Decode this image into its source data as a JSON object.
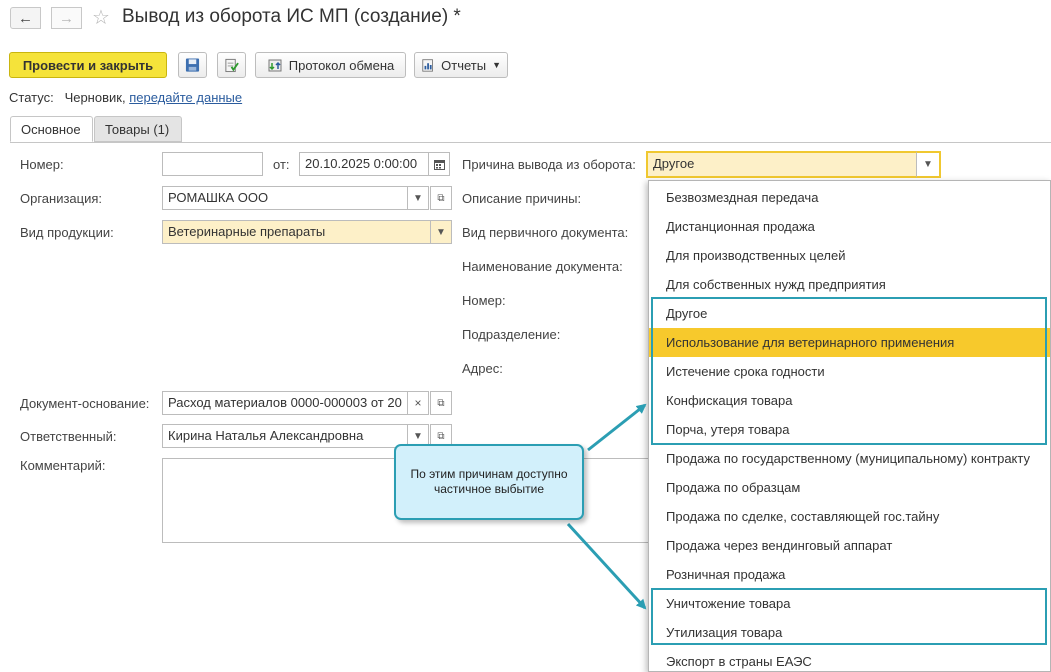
{
  "window": {
    "title": "Вывод из оборота ИС МП (создание) *"
  },
  "toolbar": {
    "post_close_label": "Провести и закрыть",
    "exchange_protocol_label": "Протокол обмена",
    "reports_label": "Отчеты"
  },
  "status": {
    "label": "Статус:",
    "value": "Черновик,",
    "link": "передайте данные"
  },
  "tabs": [
    {
      "label": "Основное",
      "active": true
    },
    {
      "label": "Товары (1)",
      "active": false
    }
  ],
  "form": {
    "number_label": "Номер:",
    "number_value": "",
    "from_label": "от:",
    "date_value": "20.10.2025  0:00:00",
    "organization_label": "Организация:",
    "organization_value": "РОМАШКА ООО",
    "product_type_label": "Вид продукции:",
    "product_type_value": "Ветеринарные препараты",
    "reason_label": "Причина вывода из оборота:",
    "reason_value": "Другое",
    "reason_desc_label": "Описание причины:",
    "primary_doc_type_label": "Вид первичного документа:",
    "doc_name_label": "Наименование документа:",
    "number2_label": "Номер:",
    "department_label": "Подразделение:",
    "address_label": "Адрес:",
    "base_doc_label": "Документ-основание:",
    "base_doc_value": "Расход материалов 0000-000003 от 20",
    "responsible_label": "Ответственный:",
    "responsible_value": "Кирина Наталья Александровна",
    "comment_label": "Комментарий:",
    "comment_value": ""
  },
  "reason_options": [
    "Безвозмездная передача",
    "Дистанционная продажа",
    "Для производственных целей",
    "Для собственных нужд предприятия",
    "Другое",
    "Использование для ветеринарного применения",
    "Истечение срока годности",
    "Конфискация товара",
    "Порча, утеря товара",
    "Продажа по государственному (муниципальному) контракту",
    "Продажа по образцам",
    "Продажа по сделке, составляющей гос.тайну",
    "Продажа через вендинговый аппарат",
    "Розничная продажа",
    "Уничтожение товара",
    "Утилизация товара",
    "Экспорт в страны ЕАЭС"
  ],
  "selected_option": "Использование для ветеринарного применения",
  "callout": {
    "text": "По этим причинам доступно частичное выбытие"
  },
  "colors": {
    "accent_yellow": "#f5e33a",
    "selected_row": "#f7c92c",
    "highlight_teal": "#2b9eb3",
    "callout_bg": "#d2f0fb",
    "link": "#2b5c9e"
  }
}
